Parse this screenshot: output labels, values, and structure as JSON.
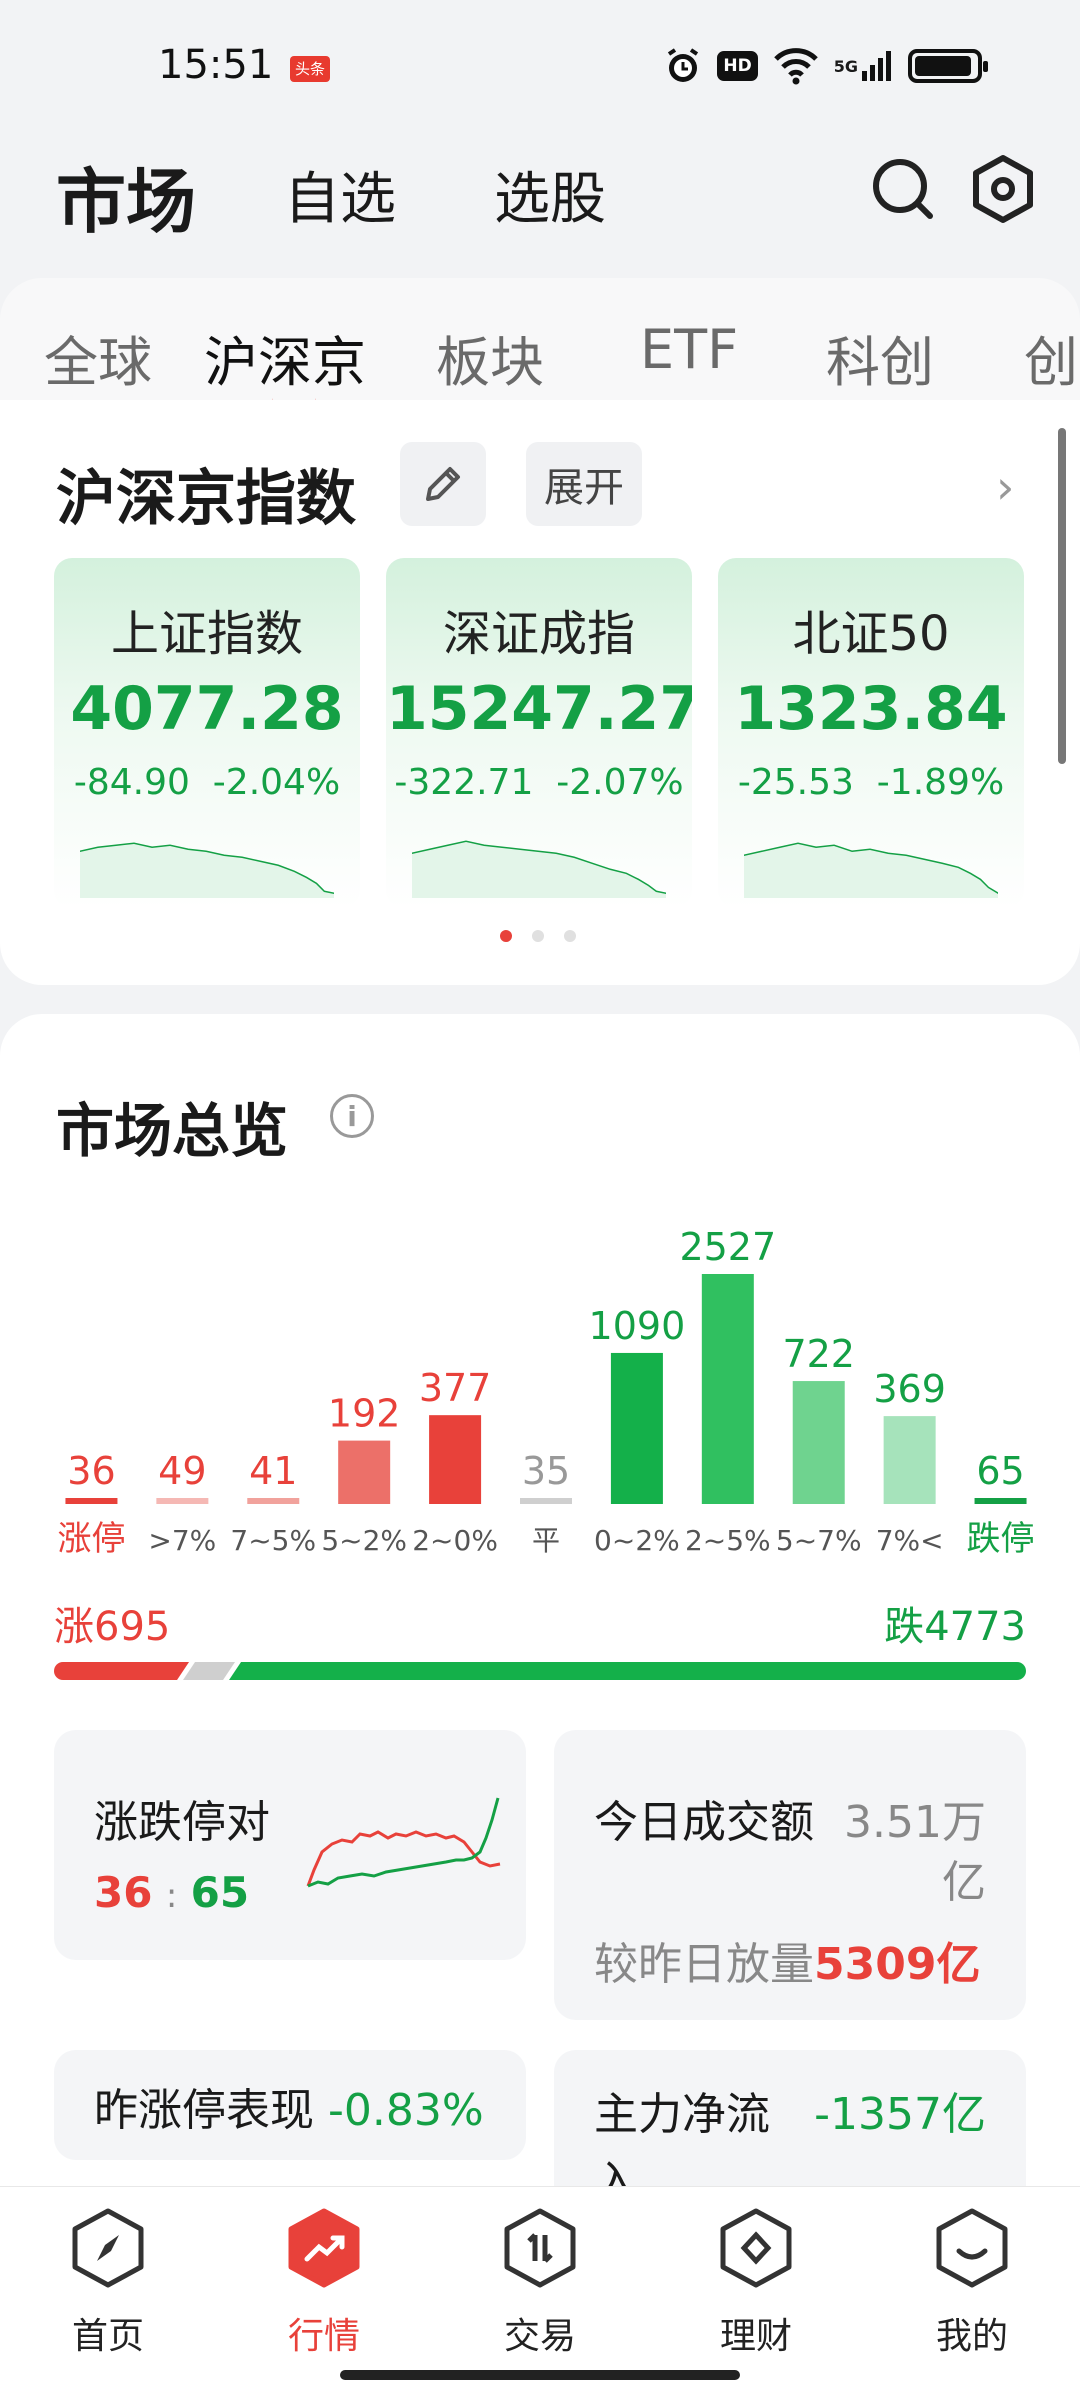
{
  "status_bar": {
    "time": "15:51",
    "badge": "头条",
    "network": "5G",
    "hd": "HD",
    "icons": [
      "alarm-icon",
      "hd-icon",
      "wifi-icon",
      "signal-icon",
      "battery-icon"
    ]
  },
  "header": {
    "tabs": [
      "市场",
      "自选",
      "选股"
    ],
    "active_tab": "市场",
    "icons": [
      "search-icon",
      "settings-icon"
    ]
  },
  "subtabs": {
    "items": [
      "全球",
      "沪深京",
      "板块",
      "ETF",
      "科创",
      "创"
    ],
    "active": "沪深京"
  },
  "index_section": {
    "title": "沪深京指数",
    "edit_icon": "pencil-icon",
    "expand_label": "展开",
    "chevron_icon": "chevron-right-icon",
    "cards": [
      {
        "name": "上证指数",
        "value": "4077.28",
        "change": "-84.90",
        "pct": "-2.04%"
      },
      {
        "name": "深证成指",
        "value": "15247.27",
        "change": "-322.71",
        "pct": "-2.07%"
      },
      {
        "name": "北证50",
        "value": "1323.84",
        "change": "-25.53",
        "pct": "-1.89%"
      }
    ],
    "pager_total": 3,
    "pager_active": 0
  },
  "overview": {
    "title": "市场总览",
    "info_icon": "info-icon",
    "up_label": "涨695",
    "down_label": "跌4773",
    "up_count": 695,
    "flat_count": 35,
    "down_count": 4773,
    "cards": {
      "limit": {
        "label": "涨跌停对",
        "up": "36",
        "sep": ":",
        "down": "65"
      },
      "turnover": {
        "label": "今日成交额",
        "value": "3.51万",
        "unit": "亿",
        "compare_label": "较昨日放量",
        "compare_value": "5309亿"
      },
      "yesterday": {
        "label": "昨涨停表现",
        "value": "-0.83%"
      },
      "netflow": {
        "label": "主力净流",
        "label2": "入",
        "value": "-1357亿"
      }
    }
  },
  "chart_data": {
    "type": "bar",
    "categories": [
      "涨停",
      ">7%",
      "7~5%",
      "5~2%",
      "2~0%",
      "平",
      "0~2%",
      "2~5%",
      "5~7%",
      "7%<",
      "跌停"
    ],
    "values": [
      36,
      49,
      41,
      192,
      377,
      35,
      1090,
      2527,
      722,
      369,
      65
    ],
    "colors": [
      "#e8413a",
      "#f5b8b4",
      "#f1a29c",
      "#ec7069",
      "#e8413a",
      "#cfcfcf",
      "#14b04a",
      "#30c060",
      "#6fd38f",
      "#a6e3bb",
      "#14a045"
    ],
    "label_colors": [
      "#e8413a",
      "#e8413a",
      "#e8413a",
      "#e8413a",
      "#e8413a",
      "#999999",
      "#14a045",
      "#14a045",
      "#14a045",
      "#14a045",
      "#14a045"
    ]
  },
  "bottom_nav": {
    "items": [
      {
        "label": "首页",
        "icon": "compass-icon"
      },
      {
        "label": "行情",
        "icon": "trend-icon"
      },
      {
        "label": "交易",
        "icon": "trade-icon"
      },
      {
        "label": "理财",
        "icon": "wealth-icon"
      },
      {
        "label": "我的",
        "icon": "profile-icon"
      }
    ],
    "active": "行情"
  }
}
